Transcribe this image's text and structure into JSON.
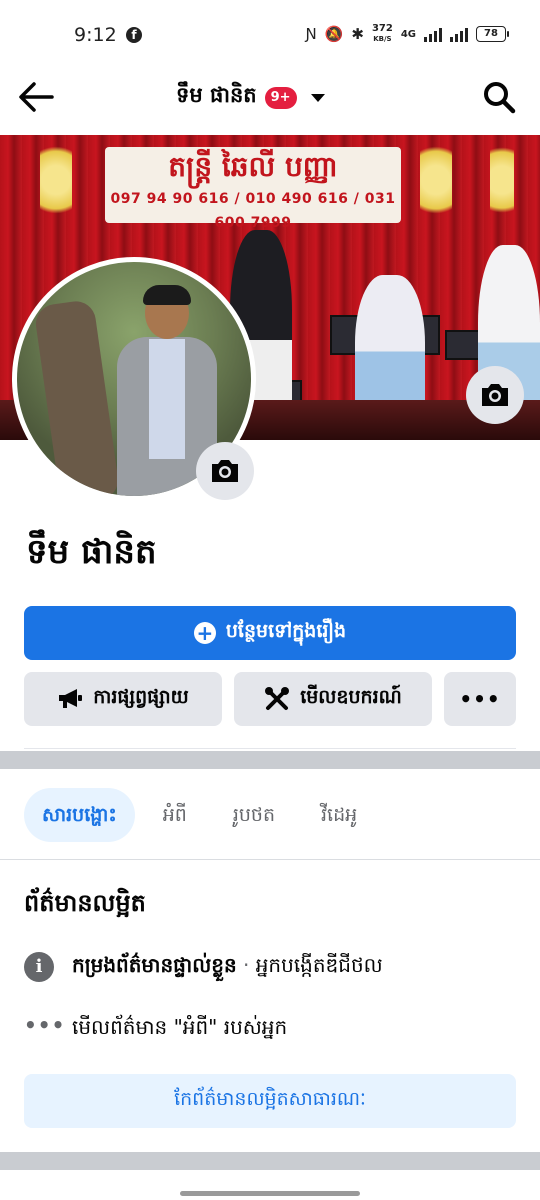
{
  "status_bar": {
    "time": "9:12",
    "app_icon": "facebook-icon",
    "speed_value": "372",
    "speed_unit": "KB/S",
    "network": "4G",
    "battery": "78"
  },
  "topnav": {
    "title": "ទឹម ផានិត",
    "badge": "9+",
    "back_icon": "arrow-left-icon",
    "search_icon": "search-icon"
  },
  "cover": {
    "banner_title": "តន្ត្រី ឆៃលី បញ្ញា",
    "banner_phones": "097 94 90 616 / 010 490 616 / 031 600 7999"
  },
  "profile": {
    "name": "ទឹម ផានិត"
  },
  "actions": {
    "add_story": "បន្ថែមទៅក្នុងរឿង",
    "promote": "ការផ្សព្វផ្សាយ",
    "tools": "មើលឧបករណ៍",
    "more": "•••"
  },
  "tabs": [
    {
      "label": "សារបង្ហោះ",
      "active": true
    },
    {
      "label": "អំពី",
      "active": false
    },
    {
      "label": "រូបថត",
      "active": false
    },
    {
      "label": "វីដេអូ",
      "active": false
    }
  ],
  "details": {
    "title": "ព័ត៌មានលម្អិត",
    "row1_bold": "កម្រងព័ត៌មានផ្ទាល់ខ្លួន",
    "row1_sep": " · ",
    "row1_rest": "អ្នកបង្កើតឌីជីថល",
    "row2": "មើលព័ត៌មាន \"អំពី\" របស់អ្នក",
    "edit_button": "កែព័ត៌មានលម្អិតសាធារណៈ"
  },
  "colors": {
    "accent": "#1b74e4",
    "badge": "#e41e3f",
    "button_gray": "#e4e6eb",
    "separator": "#c9ccd1"
  }
}
